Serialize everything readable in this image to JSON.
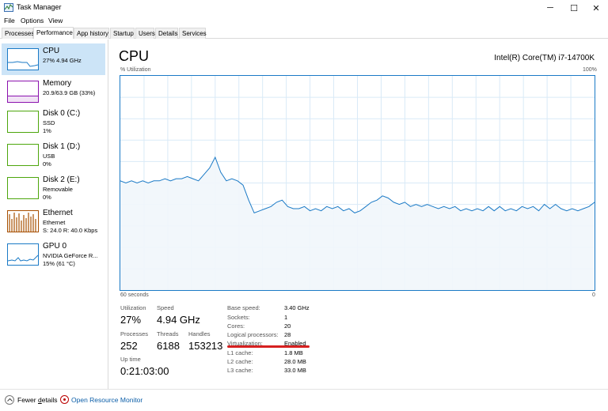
{
  "window": {
    "title": "Task Manager",
    "app_icon": "task-manager-icon",
    "controls": {
      "minimize": "─",
      "maximize": "☐",
      "close": "✕"
    }
  },
  "menu": [
    "File",
    "Options",
    "View"
  ],
  "tabs": [
    "Processes",
    "Performance",
    "App history",
    "Startup",
    "Users",
    "Details",
    "Services"
  ],
  "active_tab": "Performance",
  "sidebar": {
    "items": [
      {
        "name": "CPU",
        "line1": "27% 4.94 GHz",
        "line2": "",
        "color": "#1b7ac6",
        "selected": true
      },
      {
        "name": "Memory",
        "line1": "20.9/63.9 GB (33%)",
        "line2": "",
        "color": "#8b12ae",
        "selected": false
      },
      {
        "name": "Disk 0 (C:)",
        "line1": "SSD",
        "line2": "1%",
        "color": "#4da60c",
        "selected": false
      },
      {
        "name": "Disk 1 (D:)",
        "line1": "USB",
        "line2": "0%",
        "color": "#4da60c",
        "selected": false
      },
      {
        "name": "Disk 2 (E:)",
        "line1": "Removable",
        "line2": "0%",
        "color": "#4da60c",
        "selected": false
      },
      {
        "name": "Ethernet",
        "line1": "Ethernet",
        "line2": "S: 24.0  R: 40.0 Kbps",
        "color": "#a74f01",
        "selected": false
      },
      {
        "name": "GPU 0",
        "line1": "NVIDIA GeForce R...",
        "line2": "15% (61 °C)",
        "color": "#1b7ac6",
        "selected": false
      }
    ]
  },
  "main": {
    "title": "CPU",
    "model": "Intel(R) Core(TM) i7-14700K",
    "y_label": "% Utilization",
    "y_max": "100%",
    "x_label": "60 seconds",
    "x_min": "0",
    "graph_color": "#1b7ac6",
    "utilization_history": [
      51,
      50,
      51,
      50,
      51,
      50,
      51,
      51,
      52,
      51,
      52,
      52,
      53,
      52,
      51,
      54,
      57,
      62,
      55,
      51,
      52,
      51,
      49,
      42,
      36,
      37,
      38,
      39,
      41,
      42,
      39,
      38,
      38,
      39,
      37,
      38,
      37,
      39,
      38,
      39,
      37,
      38,
      36,
      37,
      39,
      41,
      42,
      44,
      43,
      41,
      40,
      41,
      39,
      40,
      39,
      40,
      39,
      38,
      39,
      38,
      39,
      37,
      38,
      37,
      38,
      37,
      39,
      37,
      39,
      37,
      38,
      37,
      39,
      38,
      39,
      37,
      40,
      38,
      40,
      38,
      37,
      38,
      37,
      38,
      39,
      41
    ]
  },
  "stats": {
    "utilization": {
      "label": "Utilization",
      "value": "27%"
    },
    "speed": {
      "label": "Speed",
      "value": "4.94 GHz"
    },
    "processes": {
      "label": "Processes",
      "value": "252"
    },
    "threads": {
      "label": "Threads",
      "value": "6188"
    },
    "handles": {
      "label": "Handles",
      "value": "153213"
    },
    "uptime": {
      "label": "Up time",
      "value": "0:21:03:00"
    }
  },
  "specs": [
    {
      "label": "Base speed:",
      "value": "3.40 GHz"
    },
    {
      "label": "Sockets:",
      "value": "1"
    },
    {
      "label": "Cores:",
      "value": "20"
    },
    {
      "label": "Logical processors:",
      "value": "28"
    },
    {
      "label": "Virtualization:",
      "value": "Enabled"
    },
    {
      "label": "L1 cache:",
      "value": "1.8 MB"
    },
    {
      "label": "L2 cache:",
      "value": "28.0 MB"
    },
    {
      "label": "L3 cache:",
      "value": "33.0 MB"
    }
  ],
  "annotation_color": "#d62020",
  "footer": {
    "fewer_details_prefix": "Fewer ",
    "fewer_details_underlined": "d",
    "fewer_details_suffix": "etails",
    "open_resource_monitor": "Open Resource Monitor"
  }
}
